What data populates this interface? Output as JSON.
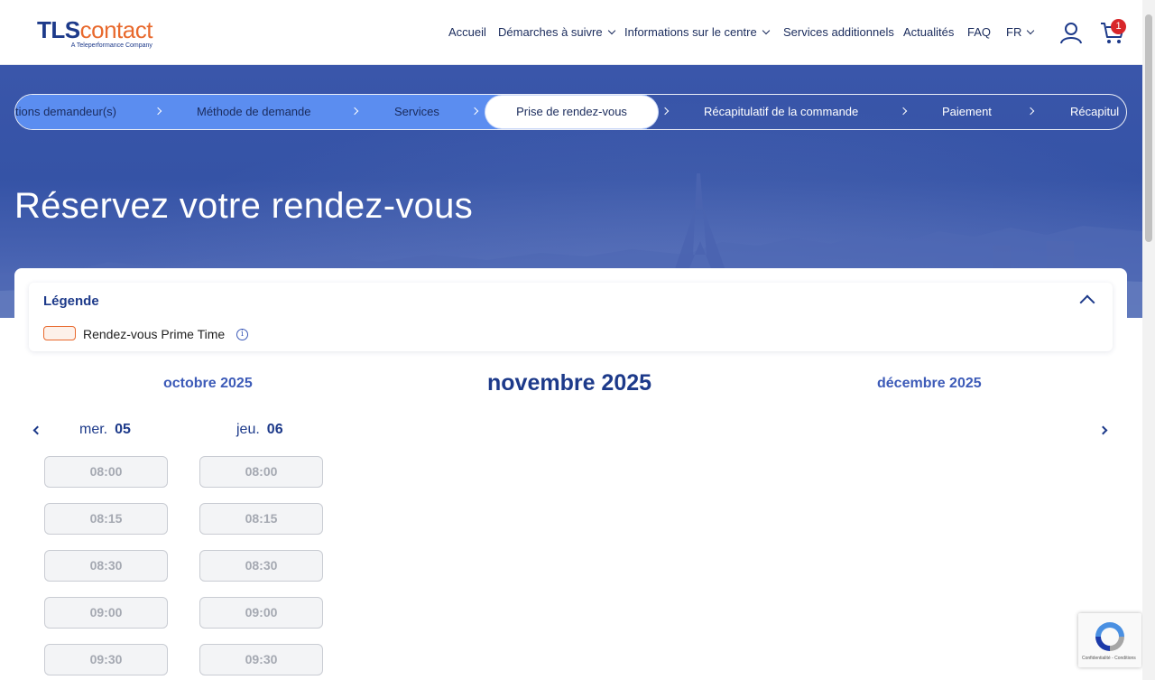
{
  "header": {
    "logo_tls": "TLS",
    "logo_contact": "contact",
    "logo_sub": "A Teleperformance Company",
    "nav": [
      "Accueil",
      "Démarches à suivre",
      "Informations sur le centre",
      "Services additionnels",
      "Actualités",
      "FAQ",
      "FR"
    ],
    "cart_count": "1"
  },
  "stepper": {
    "steps": [
      "tions demandeur(s)",
      "Méthode de demande",
      "Services",
      "Prise de rendez-vous",
      "Récapitulatif de la commande",
      "Paiement",
      "Récapitul"
    ],
    "active_index": 3
  },
  "page_title": "Réservez votre rendez-vous",
  "legend": {
    "title": "Légende",
    "item_label": "Rendez-vous Prime Time",
    "info_glyph": "i"
  },
  "calendar": {
    "prev_month": "octobre 2025",
    "current_month": "novembre 2025",
    "next_month": "décembre 2025",
    "days": [
      {
        "weekday": "mer.",
        "date": "05",
        "slots": [
          "08:00",
          "08:15",
          "08:30",
          "09:00",
          "09:30"
        ]
      },
      {
        "weekday": "jeu.",
        "date": "06",
        "slots": [
          "08:00",
          "08:15",
          "08:30",
          "09:00",
          "09:30"
        ]
      }
    ]
  },
  "recaptcha": {
    "text": "Confidentialité - Conditions"
  },
  "colors": {
    "brand_blue": "#1d3a8a",
    "brand_orange": "#e8692d",
    "stepper_fill": "#5b8df0",
    "badge": "#d8262a"
  }
}
